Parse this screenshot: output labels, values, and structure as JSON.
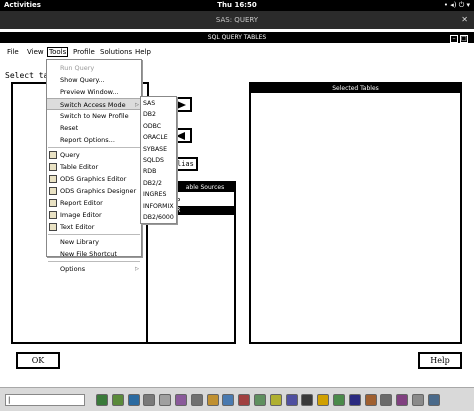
{
  "topbar": {
    "activities": "Activities",
    "clock": "Thu 16:50",
    "tray": "• ◂) ⏻ ▾"
  },
  "window": {
    "title": "SAS: QUERY",
    "close": "✕"
  },
  "sql_window": {
    "title": "SQL QUERY TABLES",
    "btns": [
      "–",
      "□"
    ]
  },
  "menubar": [
    "File",
    "View",
    "Tools",
    "Profile",
    "Solutions",
    "Help"
  ],
  "select_label": "Select ta",
  "selected_tables_header": "Selected Tables",
  "sources_header": "able Sources",
  "source_items": [
    "P",
    "R"
  ],
  "alias_label": "lias",
  "buttons": {
    "ok": "OK",
    "help": "Help"
  },
  "tools_menu": {
    "items": [
      {
        "label": "Run Query",
        "disabled": true,
        "icon": false,
        "sub": false
      },
      {
        "label": "Show Query...",
        "disabled": false,
        "icon": false,
        "sub": false
      },
      {
        "label": "Preview Window...",
        "disabled": false,
        "icon": false,
        "sub": false
      },
      {
        "label": "Switch Access Mode",
        "disabled": false,
        "icon": false,
        "sub": true,
        "highlight": true
      },
      {
        "label": "Switch to New Profile",
        "disabled": false,
        "icon": false,
        "sub": false
      },
      {
        "label": "Reset",
        "disabled": false,
        "icon": false,
        "sub": false
      },
      {
        "label": "Report Options...",
        "disabled": false,
        "icon": false,
        "sub": false
      },
      {
        "label": "Query",
        "disabled": false,
        "icon": true,
        "sub": false,
        "sep_before": true
      },
      {
        "label": "Table Editor",
        "disabled": false,
        "icon": true,
        "sub": false
      },
      {
        "label": "ODS Graphics Editor",
        "disabled": false,
        "icon": true,
        "sub": false
      },
      {
        "label": "ODS Graphics Designer",
        "disabled": false,
        "icon": true,
        "sub": false
      },
      {
        "label": "Report Editor",
        "disabled": false,
        "icon": true,
        "sub": false
      },
      {
        "label": "Image Editor",
        "disabled": false,
        "icon": true,
        "sub": false
      },
      {
        "label": "Text Editor",
        "disabled": false,
        "icon": true,
        "sub": false
      },
      {
        "label": "New Library",
        "disabled": false,
        "icon": false,
        "sub": false,
        "sep_before": true
      },
      {
        "label": "New File Shortcut",
        "disabled": false,
        "icon": false,
        "sub": false
      },
      {
        "label": "Options",
        "disabled": false,
        "icon": false,
        "sub": true,
        "sep_before": true
      }
    ]
  },
  "access_submenu": [
    "SAS",
    "DB2",
    "ODBC",
    "ORACLE",
    "SYBASE",
    "SQLDS",
    "RDB",
    "DB2/2",
    "INGRES",
    "INFORMIX",
    "DB2/6000"
  ],
  "taskbar": {
    "field": "|"
  }
}
